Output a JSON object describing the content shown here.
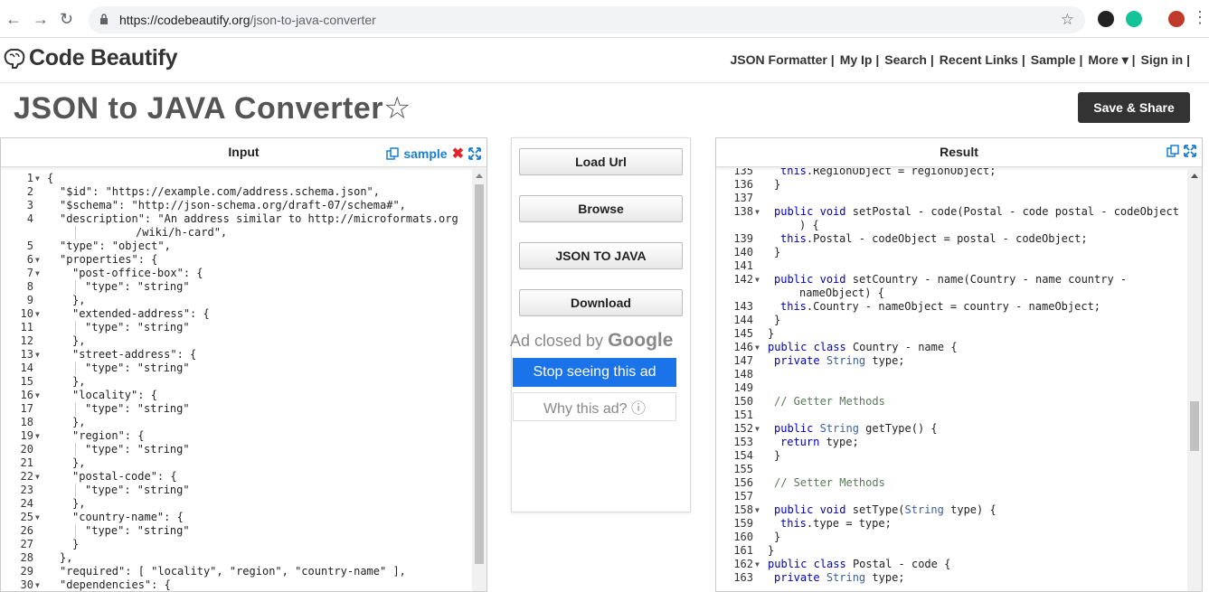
{
  "browser": {
    "url_host": "https://codebeautify.org",
    "url_path": "/json-to-java-converter"
  },
  "site": {
    "logo_text": "Code Beautify",
    "nav": [
      "JSON Formatter |",
      "My Ip |",
      "Search |",
      "Recent Links |",
      "Sample |",
      "More ▾ |",
      "Sign in |"
    ]
  },
  "page": {
    "title": "JSON to JAVA Converter",
    "save_label": "Save & Share"
  },
  "input_panel": {
    "title": "Input",
    "sample_label": "sample",
    "lines": [
      {
        "n": "1",
        "fold": true,
        "indent": 0,
        "html": "{"
      },
      {
        "n": "2",
        "fold": false,
        "indent": 1,
        "html": "\"$id\": \"https://example.com/address.schema.json\","
      },
      {
        "n": "3",
        "fold": false,
        "indent": 1,
        "html": "\"$schema\": \"http://json-schema.org/draft-07/schema#\","
      },
      {
        "n": "4",
        "fold": false,
        "indent": 1,
        "html": "\"description\": \"An address similar to http://microformats.org"
      },
      {
        "n": "",
        "fold": false,
        "indent": 7,
        "html": "/wiki/h-card\","
      },
      {
        "n": "5",
        "fold": false,
        "indent": 1,
        "html": "\"type\": \"object\","
      },
      {
        "n": "6",
        "fold": true,
        "indent": 1,
        "html": "\"properties\": {"
      },
      {
        "n": "7",
        "fold": true,
        "indent": 2,
        "html": "\"post-office-box\": {"
      },
      {
        "n": "8",
        "fold": false,
        "indent": 3,
        "html": "\"type\": \"string\""
      },
      {
        "n": "9",
        "fold": false,
        "indent": 2,
        "html": "},"
      },
      {
        "n": "10",
        "fold": true,
        "indent": 2,
        "html": "\"extended-address\": {"
      },
      {
        "n": "11",
        "fold": false,
        "indent": 3,
        "html": "\"type\": \"string\""
      },
      {
        "n": "12",
        "fold": false,
        "indent": 2,
        "html": "},"
      },
      {
        "n": "13",
        "fold": true,
        "indent": 2,
        "html": "\"street-address\": {"
      },
      {
        "n": "14",
        "fold": false,
        "indent": 3,
        "html": "\"type\": \"string\""
      },
      {
        "n": "15",
        "fold": false,
        "indent": 2,
        "html": "},"
      },
      {
        "n": "16",
        "fold": true,
        "indent": 2,
        "html": "\"locality\": {"
      },
      {
        "n": "17",
        "fold": false,
        "indent": 3,
        "html": "\"type\": \"string\""
      },
      {
        "n": "18",
        "fold": false,
        "indent": 2,
        "html": "},"
      },
      {
        "n": "19",
        "fold": true,
        "indent": 2,
        "html": "\"region\": {"
      },
      {
        "n": "20",
        "fold": false,
        "indent": 3,
        "html": "\"type\": \"string\""
      },
      {
        "n": "21",
        "fold": false,
        "indent": 2,
        "html": "},"
      },
      {
        "n": "22",
        "fold": true,
        "indent": 2,
        "html": "\"postal-code\": {"
      },
      {
        "n": "23",
        "fold": false,
        "indent": 3,
        "html": "\"type\": \"string\""
      },
      {
        "n": "24",
        "fold": false,
        "indent": 2,
        "html": "},"
      },
      {
        "n": "25",
        "fold": true,
        "indent": 2,
        "html": "\"country-name\": {"
      },
      {
        "n": "26",
        "fold": false,
        "indent": 3,
        "html": "\"type\": \"string\""
      },
      {
        "n": "27",
        "fold": false,
        "indent": 2,
        "html": "}"
      },
      {
        "n": "28",
        "fold": false,
        "indent": 1,
        "html": "},"
      },
      {
        "n": "29",
        "fold": false,
        "indent": 1,
        "html": "\"required\": [ \"locality\", \"region\", \"country-name\" ],"
      },
      {
        "n": "30",
        "fold": true,
        "indent": 1,
        "html": "\"dependencies\": {"
      }
    ]
  },
  "middle": {
    "buttons": [
      "Load Url",
      "Browse",
      "JSON TO JAVA",
      "Download"
    ],
    "ad_closed_prefix": "Ad closed by",
    "ad_closed_brand": "Google",
    "ad_stop": "Stop seeing this ad",
    "ad_why": "Why this ad? ⓘ"
  },
  "result_panel": {
    "title": "Result",
    "lines": [
      {
        "n": "135",
        "fold": false,
        "indent": 2,
        "text": "this.RegionObject = regionObject;"
      },
      {
        "n": "136",
        "fold": false,
        "indent": 1,
        "text": "}"
      },
      {
        "n": "137",
        "fold": false,
        "indent": 0,
        "text": ""
      },
      {
        "n": "138",
        "fold": true,
        "indent": 1,
        "text": "public void setPostal - code(Postal - code postal - codeObject"
      },
      {
        "n": "",
        "fold": false,
        "indent": 5,
        "text": ") {"
      },
      {
        "n": "139",
        "fold": false,
        "indent": 2,
        "text": "this.Postal - codeObject = postal - codeObject;"
      },
      {
        "n": "140",
        "fold": false,
        "indent": 1,
        "text": "}"
      },
      {
        "n": "141",
        "fold": false,
        "indent": 0,
        "text": ""
      },
      {
        "n": "142",
        "fold": true,
        "indent": 1,
        "text": "public void setCountry - name(Country - name country -"
      },
      {
        "n": "",
        "fold": false,
        "indent": 5,
        "text": "nameObject) {"
      },
      {
        "n": "143",
        "fold": false,
        "indent": 2,
        "text": "this.Country - nameObject = country - nameObject;"
      },
      {
        "n": "144",
        "fold": false,
        "indent": 1,
        "text": "}"
      },
      {
        "n": "145",
        "fold": false,
        "indent": 0,
        "text": "}"
      },
      {
        "n": "146",
        "fold": true,
        "indent": 0,
        "text": "public class Country - name {"
      },
      {
        "n": "147",
        "fold": false,
        "indent": 1,
        "text": "private String type;"
      },
      {
        "n": "148",
        "fold": false,
        "indent": 0,
        "text": ""
      },
      {
        "n": "149",
        "fold": false,
        "indent": 0,
        "text": ""
      },
      {
        "n": "150",
        "fold": false,
        "indent": 1,
        "text": "// Getter Methods"
      },
      {
        "n": "151",
        "fold": false,
        "indent": 0,
        "text": ""
      },
      {
        "n": "152",
        "fold": true,
        "indent": 1,
        "text": "public String getType() {"
      },
      {
        "n": "153",
        "fold": false,
        "indent": 2,
        "text": "return type;"
      },
      {
        "n": "154",
        "fold": false,
        "indent": 1,
        "text": "}"
      },
      {
        "n": "155",
        "fold": false,
        "indent": 0,
        "text": ""
      },
      {
        "n": "156",
        "fold": false,
        "indent": 1,
        "text": "// Setter Methods"
      },
      {
        "n": "157",
        "fold": false,
        "indent": 0,
        "text": ""
      },
      {
        "n": "158",
        "fold": true,
        "indent": 1,
        "text": "public void setType(String type) {"
      },
      {
        "n": "159",
        "fold": false,
        "indent": 2,
        "text": "this.type = type;"
      },
      {
        "n": "160",
        "fold": false,
        "indent": 1,
        "text": "}"
      },
      {
        "n": "161",
        "fold": false,
        "indent": 0,
        "text": "}"
      },
      {
        "n": "162",
        "fold": true,
        "indent": 0,
        "text": "public class Postal - code {"
      },
      {
        "n": "163",
        "fold": false,
        "indent": 1,
        "text": "private String type;"
      }
    ]
  },
  "colors": {
    "accent_blue": "#1a7fd4",
    "close_red": "#e0242a",
    "save_bg": "#333333",
    "ad_blue": "#1a73e8"
  }
}
